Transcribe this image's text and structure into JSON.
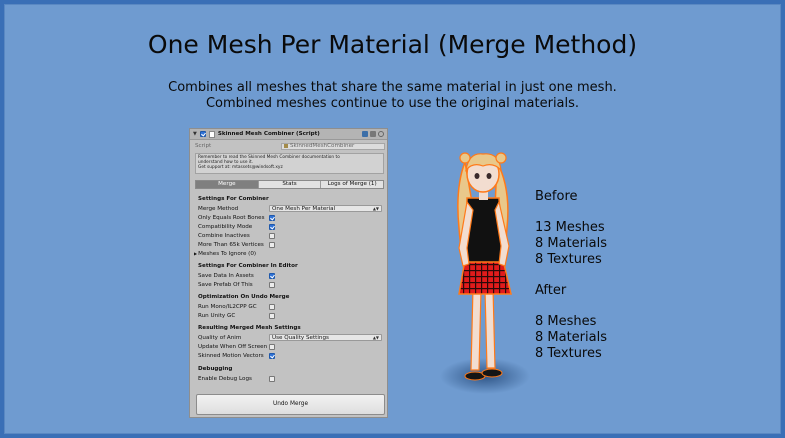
{
  "slide": {
    "title": "One Mesh Per Material (Merge Method)",
    "subtitle_lines": [
      "Combines all meshes that share the same material in just one mesh.",
      "Combined meshes continue to use the original materials."
    ]
  },
  "inspector": {
    "component_title": "Skinned Mesh Combiner (Script)",
    "component_enabled": true,
    "script_label": "Script",
    "script_value": "SkinnedMeshCombiner",
    "help_lines": [
      "Remember to read the Skinned Mesh Combiner documentation to",
      "understand how to use it.",
      "Get support at: mtassets@windsoft.xyz"
    ],
    "tabs": [
      {
        "label": "Merge",
        "active": true
      },
      {
        "label": "Stats",
        "active": false
      },
      {
        "label": "Logs of Merge (1)",
        "active": false
      }
    ],
    "settings_for_combiner": {
      "title": "Settings For Combiner",
      "merge_method_label": "Merge Method",
      "merge_method_value": "One Mesh Per Material",
      "only_equals_root_bones": {
        "label": "Only Equals Root Bones",
        "checked": true
      },
      "compatibility_mode": {
        "label": "Compatibility Mode",
        "checked": true
      },
      "combine_inactives": {
        "label": "Combine Inactives",
        "checked": false
      },
      "more_than_65k": {
        "label": "More Than 65k Vertices",
        "checked": false
      },
      "meshes_to_ignore": "Meshes To Ignore (0)"
    },
    "settings_in_editor": {
      "title": "Settings For Combiner In Editor",
      "save_data_in_assets": {
        "label": "Save Data In Assets",
        "checked": true
      },
      "save_prefab_of_this": {
        "label": "Save Prefab Of This",
        "checked": false
      }
    },
    "optimization": {
      "title": "Optimization On Undo Merge",
      "run_mono_gc": {
        "label": "Run Mono/IL2CPP GC",
        "checked": false
      },
      "run_unity_gc": {
        "label": "Run Unity GC",
        "checked": false
      }
    },
    "resulting_mesh": {
      "title": "Resulting Merged Mesh Settings",
      "quality_label": "Quality of Anim",
      "quality_value": "Use Quality Settings",
      "update_when_off": {
        "label": "Update When Off Screen",
        "checked": false
      },
      "skinned_motion_vectors": {
        "label": "Skinned Motion Vectors",
        "checked": true
      }
    },
    "debugging": {
      "title": "Debugging",
      "enable_debug_logs": {
        "label": "Enable Debug Logs",
        "checked": false
      }
    },
    "undo_button": "Undo Merge"
  },
  "stats": {
    "before_title": "Before",
    "before": [
      "13 Meshes",
      "8 Materials",
      "8 Textures"
    ],
    "after_title": "After",
    "after": [
      "8 Meshes",
      "8 Materials",
      "8 Textures"
    ]
  },
  "colors": {
    "background": "#6f9bd0",
    "frame": "#3a6fb6",
    "panel": "#c2c2c2",
    "checkbox_on": "#2f72d6",
    "outline_glow": "#ff7a1a"
  }
}
